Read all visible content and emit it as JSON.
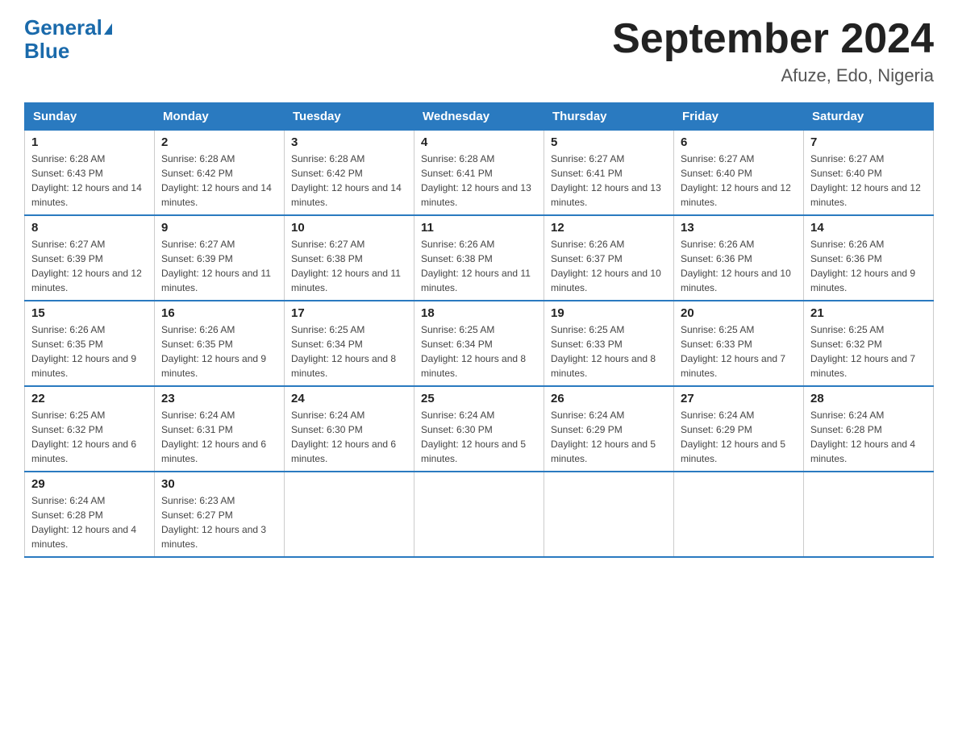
{
  "header": {
    "logo_line1": "General",
    "logo_line2": "Blue",
    "title": "September 2024",
    "subtitle": "Afuze, Edo, Nigeria"
  },
  "weekdays": [
    "Sunday",
    "Monday",
    "Tuesday",
    "Wednesday",
    "Thursday",
    "Friday",
    "Saturday"
  ],
  "weeks": [
    [
      {
        "day": "1",
        "sunrise": "6:28 AM",
        "sunset": "6:43 PM",
        "daylight": "12 hours and 14 minutes."
      },
      {
        "day": "2",
        "sunrise": "6:28 AM",
        "sunset": "6:42 PM",
        "daylight": "12 hours and 14 minutes."
      },
      {
        "day": "3",
        "sunrise": "6:28 AM",
        "sunset": "6:42 PM",
        "daylight": "12 hours and 14 minutes."
      },
      {
        "day": "4",
        "sunrise": "6:28 AM",
        "sunset": "6:41 PM",
        "daylight": "12 hours and 13 minutes."
      },
      {
        "day": "5",
        "sunrise": "6:27 AM",
        "sunset": "6:41 PM",
        "daylight": "12 hours and 13 minutes."
      },
      {
        "day": "6",
        "sunrise": "6:27 AM",
        "sunset": "6:40 PM",
        "daylight": "12 hours and 12 minutes."
      },
      {
        "day": "7",
        "sunrise": "6:27 AM",
        "sunset": "6:40 PM",
        "daylight": "12 hours and 12 minutes."
      }
    ],
    [
      {
        "day": "8",
        "sunrise": "6:27 AM",
        "sunset": "6:39 PM",
        "daylight": "12 hours and 12 minutes."
      },
      {
        "day": "9",
        "sunrise": "6:27 AM",
        "sunset": "6:39 PM",
        "daylight": "12 hours and 11 minutes."
      },
      {
        "day": "10",
        "sunrise": "6:27 AM",
        "sunset": "6:38 PM",
        "daylight": "12 hours and 11 minutes."
      },
      {
        "day": "11",
        "sunrise": "6:26 AM",
        "sunset": "6:38 PM",
        "daylight": "12 hours and 11 minutes."
      },
      {
        "day": "12",
        "sunrise": "6:26 AM",
        "sunset": "6:37 PM",
        "daylight": "12 hours and 10 minutes."
      },
      {
        "day": "13",
        "sunrise": "6:26 AM",
        "sunset": "6:36 PM",
        "daylight": "12 hours and 10 minutes."
      },
      {
        "day": "14",
        "sunrise": "6:26 AM",
        "sunset": "6:36 PM",
        "daylight": "12 hours and 9 minutes."
      }
    ],
    [
      {
        "day": "15",
        "sunrise": "6:26 AM",
        "sunset": "6:35 PM",
        "daylight": "12 hours and 9 minutes."
      },
      {
        "day": "16",
        "sunrise": "6:26 AM",
        "sunset": "6:35 PM",
        "daylight": "12 hours and 9 minutes."
      },
      {
        "day": "17",
        "sunrise": "6:25 AM",
        "sunset": "6:34 PM",
        "daylight": "12 hours and 8 minutes."
      },
      {
        "day": "18",
        "sunrise": "6:25 AM",
        "sunset": "6:34 PM",
        "daylight": "12 hours and 8 minutes."
      },
      {
        "day": "19",
        "sunrise": "6:25 AM",
        "sunset": "6:33 PM",
        "daylight": "12 hours and 8 minutes."
      },
      {
        "day": "20",
        "sunrise": "6:25 AM",
        "sunset": "6:33 PM",
        "daylight": "12 hours and 7 minutes."
      },
      {
        "day": "21",
        "sunrise": "6:25 AM",
        "sunset": "6:32 PM",
        "daylight": "12 hours and 7 minutes."
      }
    ],
    [
      {
        "day": "22",
        "sunrise": "6:25 AM",
        "sunset": "6:32 PM",
        "daylight": "12 hours and 6 minutes."
      },
      {
        "day": "23",
        "sunrise": "6:24 AM",
        "sunset": "6:31 PM",
        "daylight": "12 hours and 6 minutes."
      },
      {
        "day": "24",
        "sunrise": "6:24 AM",
        "sunset": "6:30 PM",
        "daylight": "12 hours and 6 minutes."
      },
      {
        "day": "25",
        "sunrise": "6:24 AM",
        "sunset": "6:30 PM",
        "daylight": "12 hours and 5 minutes."
      },
      {
        "day": "26",
        "sunrise": "6:24 AM",
        "sunset": "6:29 PM",
        "daylight": "12 hours and 5 minutes."
      },
      {
        "day": "27",
        "sunrise": "6:24 AM",
        "sunset": "6:29 PM",
        "daylight": "12 hours and 5 minutes."
      },
      {
        "day": "28",
        "sunrise": "6:24 AM",
        "sunset": "6:28 PM",
        "daylight": "12 hours and 4 minutes."
      }
    ],
    [
      {
        "day": "29",
        "sunrise": "6:24 AM",
        "sunset": "6:28 PM",
        "daylight": "12 hours and 4 minutes."
      },
      {
        "day": "30",
        "sunrise": "6:23 AM",
        "sunset": "6:27 PM",
        "daylight": "12 hours and 3 minutes."
      },
      null,
      null,
      null,
      null,
      null
    ]
  ]
}
